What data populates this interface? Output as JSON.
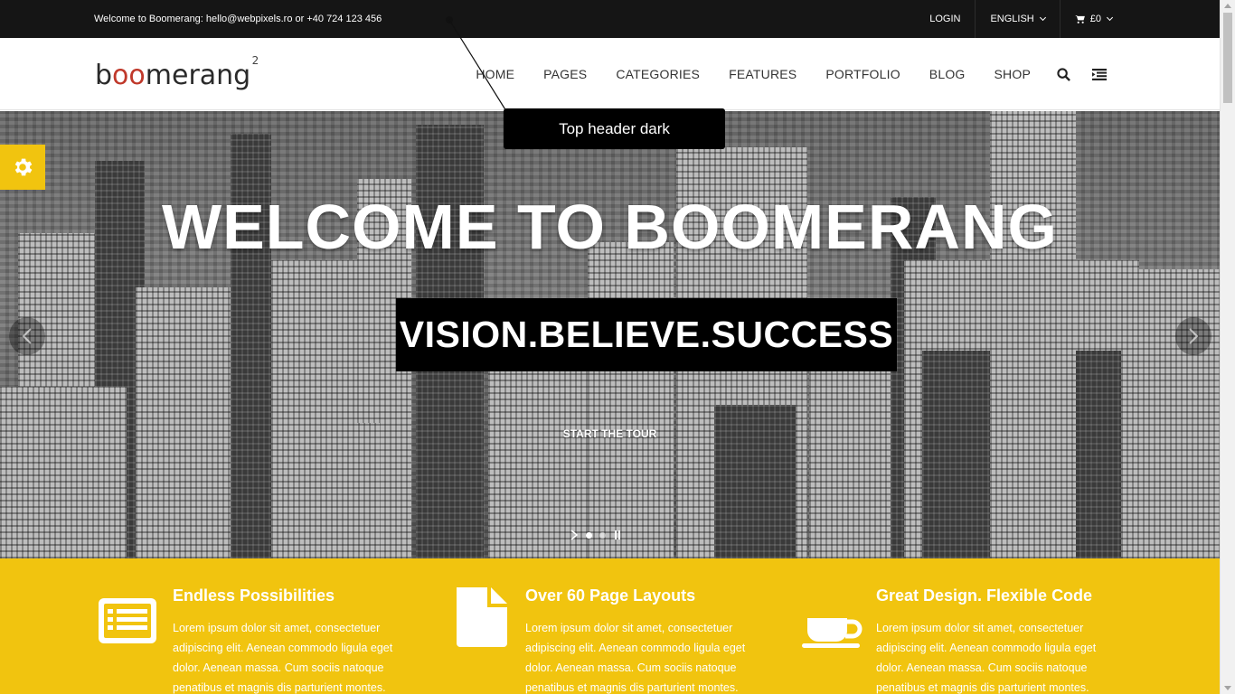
{
  "topbar": {
    "welcome": "Welcome to Boomerang: hello@webpixels.ro or +40 724 123 456",
    "login": "LOGIN",
    "language": "ENGLISH",
    "cart": "£0"
  },
  "header": {
    "logo_pre": "b",
    "logo_oo": "oo",
    "logo_post": "merang",
    "logo_sup": "2",
    "nav": [
      "HOME",
      "PAGES",
      "CATEGORIES",
      "FEATURES",
      "PORTFOLIO",
      "BLOG",
      "SHOP"
    ]
  },
  "tooltip": {
    "text": "Top header dark"
  },
  "hero": {
    "title": "WELCOME TO BOOMERANG",
    "subtitle": "VISION.BELIEVE.SUCCESS",
    "cta": "START THE TOUR"
  },
  "features": [
    {
      "title": "Endless Possibilities",
      "icon": "list-icon",
      "text": "Lorem ipsum dolor sit amet, consectetuer adipiscing elit. Aenean commodo ligula eget dolor. Aenean massa. Cum sociis natoque penatibus et magnis dis parturient montes."
    },
    {
      "title": "Over 60 Page Layouts",
      "icon": "document-icon",
      "text": "Lorem ipsum dolor sit amet, consectetuer adipiscing elit. Aenean commodo ligula eget dolor. Aenean massa. Cum sociis natoque penatibus et magnis dis parturient montes."
    },
    {
      "title": "Great Design. Flexible Code",
      "icon": "coffee-cup-icon",
      "text": "Lorem ipsum dolor sit amet, consectetuer adipiscing elit. Aenean commodo ligula eget dolor. Aenean massa. Cum sociis natoque penatibus et magnis dis parturient montes."
    }
  ],
  "colors": {
    "accent": "#f1c40f",
    "topbar": "#151515",
    "logo_accent": "#c0392b"
  }
}
